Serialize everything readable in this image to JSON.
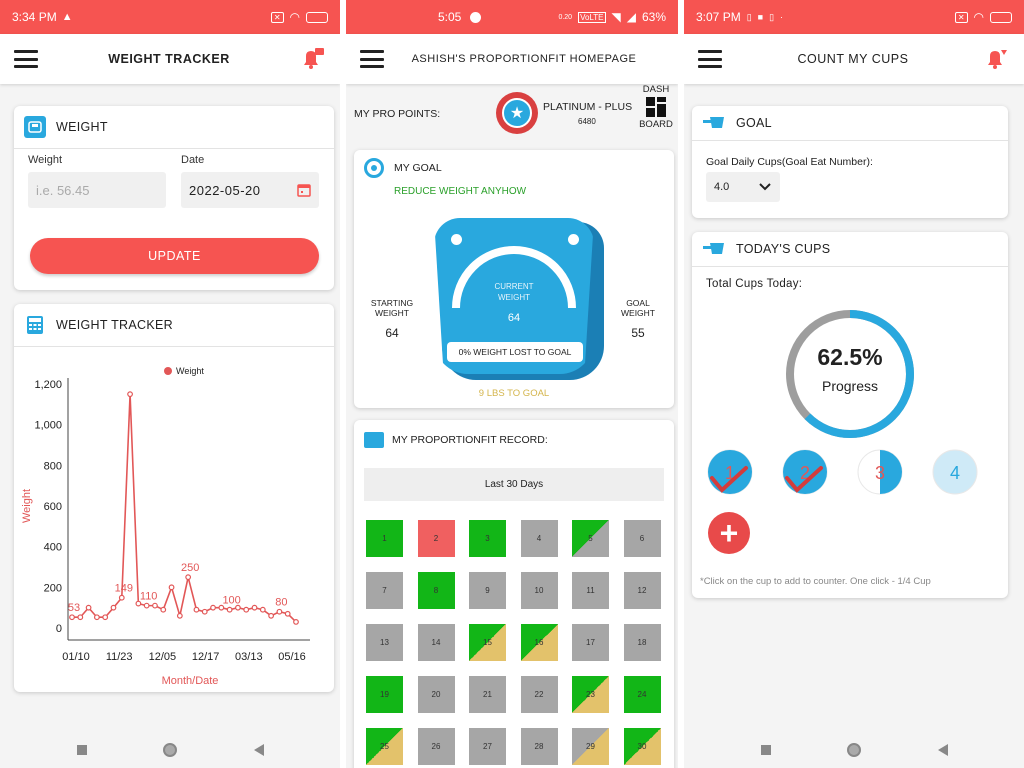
{
  "panel1": {
    "status": {
      "time": "3:34 PM"
    },
    "appbar": {
      "title": "WEIGHT TRACKER"
    },
    "weight_card": {
      "title": "WEIGHT",
      "weight_label": "Weight",
      "weight_placeholder": "i.e. 56.45",
      "date_label": "Date",
      "date_value": "2022-05-20",
      "update_label": "UPDATE"
    },
    "tracker_card": {
      "title": "WEIGHT TRACKER"
    },
    "chart_data": {
      "type": "line",
      "title": "",
      "xlabel": "Month/Date",
      "ylabel": "Weight",
      "legend": "Weight",
      "legend_position": "top",
      "ylim": [
        0,
        1200
      ],
      "y_ticks": [
        "0",
        "200",
        "400",
        "600",
        "800",
        "1,000",
        "1,200"
      ],
      "x_ticks": [
        "01/10",
        "11/23",
        "12/05",
        "12/17",
        "03/13",
        "05/16"
      ],
      "values": [
        53,
        53,
        100,
        53,
        53,
        100,
        149,
        1150,
        120,
        110,
        110,
        90,
        200,
        60,
        250,
        90,
        80,
        100,
        100,
        90,
        100,
        90,
        100,
        90,
        60,
        80,
        70,
        30
      ],
      "data_labels": [
        {
          "index": 0,
          "text": "53"
        },
        {
          "index": 6,
          "text": "149"
        },
        {
          "index": 9,
          "text": "110"
        },
        {
          "index": 14,
          "text": "250"
        },
        {
          "index": 19,
          "text": "100"
        },
        {
          "index": 25,
          "text": "80"
        }
      ],
      "color": "#e25757"
    }
  },
  "panel2": {
    "status": {
      "time": "5:05",
      "battery": "63%"
    },
    "appbar": {
      "title": "ASHISH'S PROPORTIONFIT HOMEPAGE"
    },
    "pro_points_label": "MY PRO POINTS:",
    "tier_label": "PLATINUM - PLUS",
    "points_value": "6480",
    "dash_label": "DASH",
    "board_label": "BOARD",
    "goal_card": {
      "title": "MY GOAL",
      "subtitle": "REDUCE WEIGHT ANYHOW",
      "starting_label_1": "STARTING",
      "starting_label_2": "WEIGHT",
      "starting_value": "64",
      "current_label_1": "CURRENT",
      "current_label_2": "WEIGHT",
      "current_value": "64",
      "goal_label_1": "GOAL",
      "goal_label_2": "WEIGHT",
      "goal_value": "55",
      "lost_text": "0% WEIGHT LOST TO GOAL",
      "to_goal_text": "9 LBS TO GOAL"
    },
    "record_card": {
      "title": "MY PROPORTIONFIT RECORD:",
      "range_label": "Last 30 Days",
      "days": [
        {
          "n": "1",
          "c": "green"
        },
        {
          "n": "2",
          "c": "red"
        },
        {
          "n": "3",
          "c": "green"
        },
        {
          "n": "4",
          "c": "gray"
        },
        {
          "n": "5",
          "c": "green-gray"
        },
        {
          "n": "6",
          "c": "gray"
        },
        {
          "n": "7",
          "c": "gray"
        },
        {
          "n": "8",
          "c": "green"
        },
        {
          "n": "9",
          "c": "gray"
        },
        {
          "n": "10",
          "c": "gray"
        },
        {
          "n": "11",
          "c": "gray"
        },
        {
          "n": "12",
          "c": "gray"
        },
        {
          "n": "13",
          "c": "gray"
        },
        {
          "n": "14",
          "c": "gray"
        },
        {
          "n": "15",
          "c": "green-yellow"
        },
        {
          "n": "16",
          "c": "green-yellow"
        },
        {
          "n": "17",
          "c": "gray"
        },
        {
          "n": "18",
          "c": "gray"
        },
        {
          "n": "19",
          "c": "green"
        },
        {
          "n": "20",
          "c": "gray"
        },
        {
          "n": "21",
          "c": "gray"
        },
        {
          "n": "22",
          "c": "gray"
        },
        {
          "n": "23",
          "c": "green-yellow"
        },
        {
          "n": "24",
          "c": "green"
        },
        {
          "n": "25",
          "c": "green-yellow"
        },
        {
          "n": "26",
          "c": "gray"
        },
        {
          "n": "27",
          "c": "gray"
        },
        {
          "n": "28",
          "c": "gray"
        },
        {
          "n": "29",
          "c": "gray-yellow"
        },
        {
          "n": "30",
          "c": "green-yellow"
        }
      ]
    }
  },
  "panel3": {
    "status": {
      "time": "3:07 PM"
    },
    "appbar": {
      "title": "COUNT MY CUPS"
    },
    "goal_card": {
      "title": "GOAL",
      "label": "Goal Daily Cups(Goal Eat Number):",
      "select_value": "4.0"
    },
    "cups_card": {
      "title": "TODAY'S CUPS",
      "total_label": "Total Cups Today:",
      "progress_text": "62.5%",
      "progress_label": "Progress",
      "progress_fraction": 0.625,
      "cups": [
        {
          "n": "1",
          "fill": 1.0,
          "checked": true
        },
        {
          "n": "2",
          "fill": 1.0,
          "checked": true
        },
        {
          "n": "3",
          "fill": 0.5,
          "checked": false
        },
        {
          "n": "4",
          "fill": 0.0,
          "checked": false
        }
      ],
      "footnote": "*Click on the cup to add to counter. One click - 1/4 Cup"
    }
  },
  "colors": {
    "accent": "#f65451",
    "blue": "#29a8de",
    "green": "#12b617",
    "gray": "#a6a6a6",
    "yellow": "#e3c26b",
    "red": "#f06060"
  }
}
